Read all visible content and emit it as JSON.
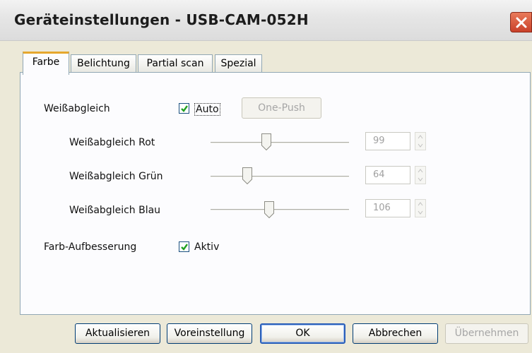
{
  "window": {
    "title": "Geräteinstellungen - USB-CAM-052H"
  },
  "tabs": [
    {
      "label": "Farbe",
      "active": true
    },
    {
      "label": "Belichtung",
      "active": false
    },
    {
      "label": "Partial scan",
      "active": false
    },
    {
      "label": "Spezial",
      "active": false
    }
  ],
  "white_balance": {
    "label": "Weißabgleich",
    "auto_label": "Auto",
    "auto_checked": true,
    "one_push_label": "One-Push"
  },
  "sliders": [
    {
      "label": "Weißabgleich Rot",
      "value": "99"
    },
    {
      "label": "Weißabgleich Grün",
      "value": "64"
    },
    {
      "label": "Weißabgleich Blau",
      "value": "106"
    }
  ],
  "color_enhancement": {
    "label": "Farb-Aufbesserung",
    "active_label": "Aktiv",
    "active_checked": true
  },
  "buttons": {
    "refresh": "Aktualisieren",
    "defaults": "Voreinstellung",
    "ok": "OK",
    "cancel": "Abbrechen",
    "apply": "Übernehmen"
  },
  "colors": {
    "close_button": "#d0502f",
    "checkmark": "#21a121",
    "active_tab_accent": "#e6a72d"
  }
}
